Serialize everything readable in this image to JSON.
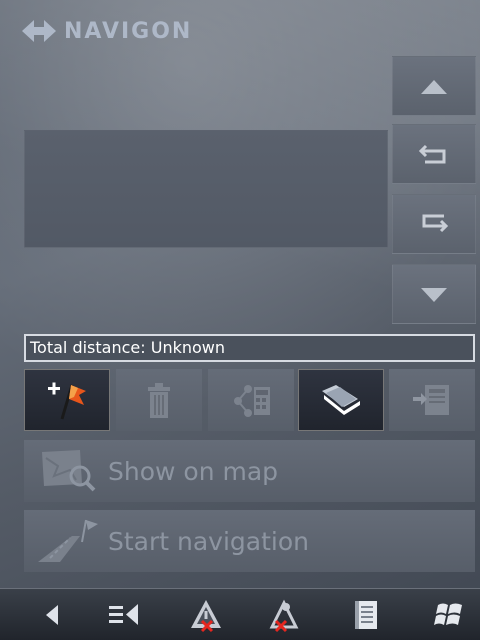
{
  "header": {
    "logo_text": "NAVIGON"
  },
  "route": {
    "total_distance_label": "Total distance: Unknown"
  },
  "side_buttons": [
    {
      "name": "scroll-up-button",
      "icon": "triangle-up-icon"
    },
    {
      "name": "move-up-button",
      "icon": "arrow-return-left-icon"
    },
    {
      "name": "move-down-button",
      "icon": "arrow-return-right-icon"
    },
    {
      "name": "scroll-down-button",
      "icon": "triangle-down-icon"
    }
  ],
  "toolbar": [
    {
      "name": "add-waypoint-button",
      "icon": "add-flag-icon",
      "active": true
    },
    {
      "name": "delete-button",
      "icon": "trash-icon",
      "active": false
    },
    {
      "name": "calculate-route-button",
      "icon": "route-calculator-icon",
      "active": false
    },
    {
      "name": "open-route-button",
      "icon": "folder-icon",
      "active": true
    },
    {
      "name": "save-route-button",
      "icon": "save-route-icon",
      "active": false
    }
  ],
  "actions": {
    "show_on_map": "Show on map",
    "start_navigation": "Start navigation"
  },
  "taskbar": [
    {
      "name": "back-button",
      "icon": "back-arrow-icon"
    },
    {
      "name": "menu-button",
      "icon": "menu-list-icon"
    },
    {
      "name": "warning-off-button",
      "icon": "warning-crossed-icon"
    },
    {
      "name": "gps-off-button",
      "icon": "satellite-crossed-icon"
    },
    {
      "name": "notes-button",
      "icon": "notepad-icon"
    },
    {
      "name": "start-menu-button",
      "icon": "windows-flag-icon"
    }
  ],
  "colors": {
    "background": "#5d6571",
    "disabled_text": "#8d95a1",
    "accent_flag": "#e8561b"
  }
}
